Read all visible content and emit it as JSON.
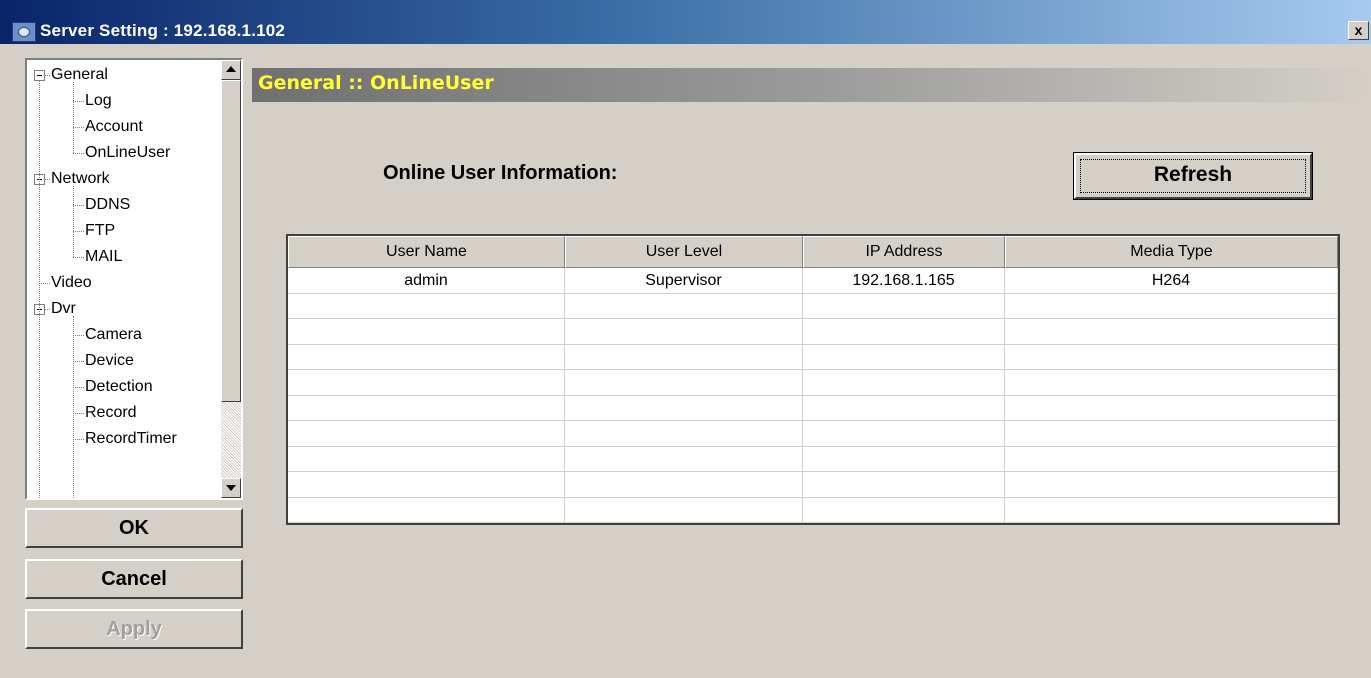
{
  "window": {
    "title": "Server Setting : 192.168.1.102",
    "close_label": "x"
  },
  "tree": {
    "items": [
      {
        "label": "General",
        "level": 0,
        "expander": true
      },
      {
        "label": "Log",
        "level": 1
      },
      {
        "label": "Account",
        "level": 1
      },
      {
        "label": "OnLineUser",
        "level": 1
      },
      {
        "label": "Network",
        "level": 0,
        "expander": true
      },
      {
        "label": "DDNS",
        "level": 1
      },
      {
        "label": "FTP",
        "level": 1
      },
      {
        "label": "MAIL",
        "level": 1
      },
      {
        "label": "Video",
        "level": 0
      },
      {
        "label": "Dvr",
        "level": 0,
        "expander": true
      },
      {
        "label": "Camera",
        "level": 1
      },
      {
        "label": "Device",
        "level": 1
      },
      {
        "label": "Detection",
        "level": 1
      },
      {
        "label": "Record",
        "level": 1
      },
      {
        "label": "RecordTimer",
        "level": 1
      }
    ]
  },
  "buttons": {
    "ok": "OK",
    "cancel": "Cancel",
    "apply": "Apply"
  },
  "panel": {
    "title": "General :: OnLineUser",
    "info_label": "Online User Information:",
    "refresh_label": "Refresh"
  },
  "table": {
    "columns": [
      "User Name",
      "User Level",
      "IP Address",
      "Media Type"
    ],
    "rows": [
      [
        "admin",
        "Supervisor",
        "192.168.1.165",
        "H264"
      ]
    ],
    "empty_rows": 9
  }
}
